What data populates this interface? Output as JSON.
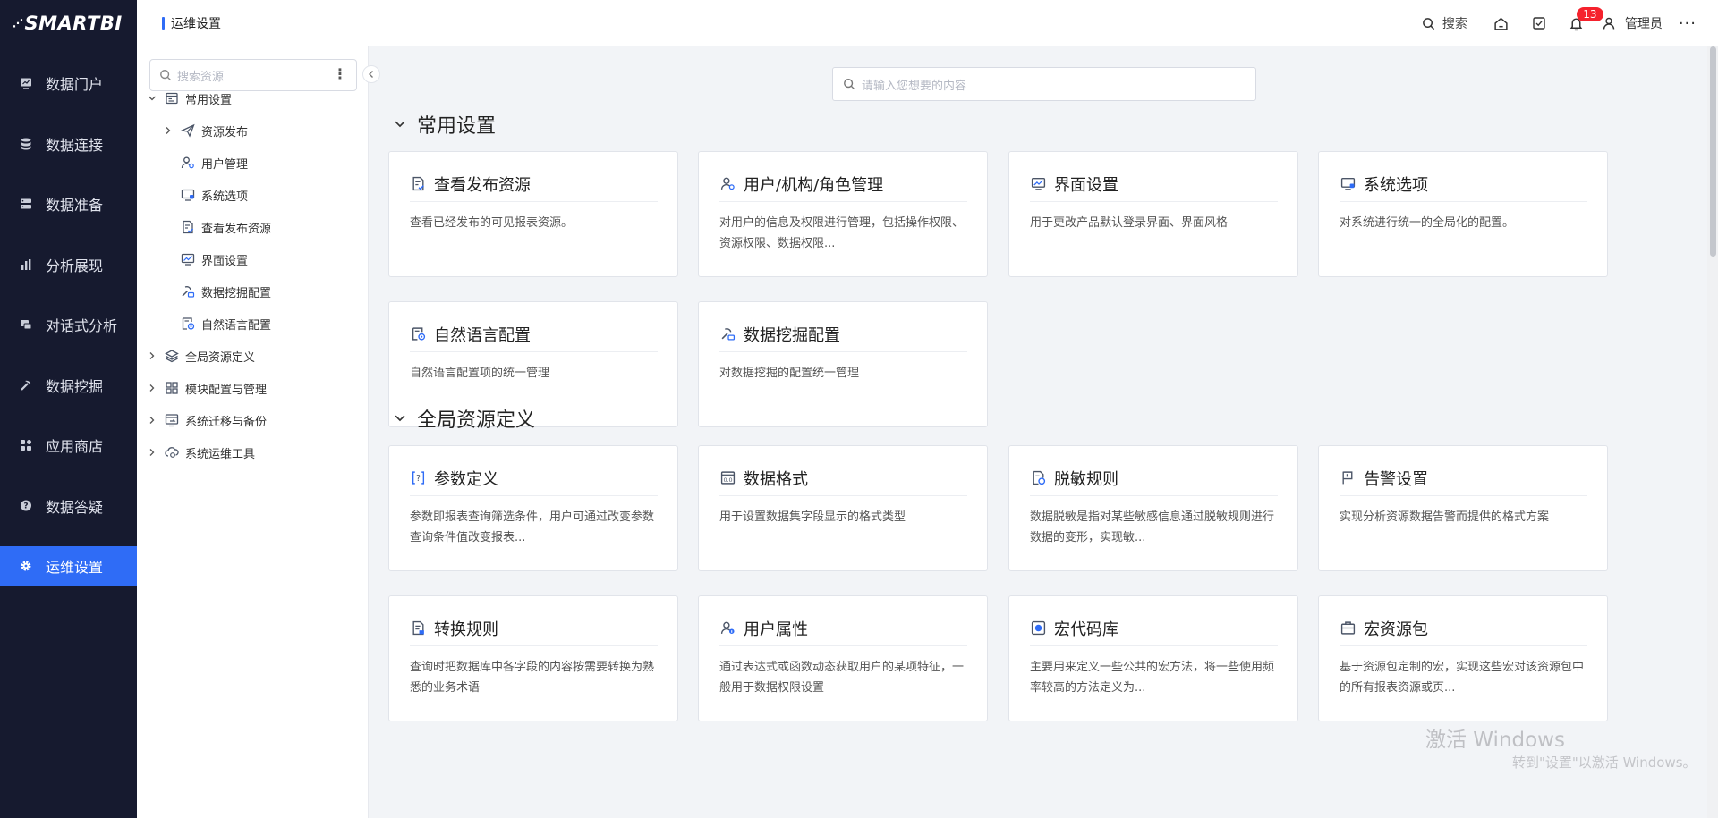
{
  "app": {
    "logo_text": "SMARTBI",
    "accent_color": "#2f6cf6",
    "nav_bg_color": "#161a2f"
  },
  "leftnav": {
    "items": [
      {
        "label": "数据门户",
        "icon": "monitor-chart-icon"
      },
      {
        "label": "数据连接",
        "icon": "database-icon"
      },
      {
        "label": "数据准备",
        "icon": "server-icon"
      },
      {
        "label": "分析展现",
        "icon": "bar-chart-icon"
      },
      {
        "label": "对话式分析",
        "icon": "chat-window-icon"
      },
      {
        "label": "数据挖掘",
        "icon": "pickaxe-icon"
      },
      {
        "label": "应用商店",
        "icon": "apps-grid-icon"
      },
      {
        "label": "数据答疑",
        "icon": "question-bubble-icon"
      },
      {
        "label": "运维设置",
        "icon": "gear-icon",
        "active": true
      }
    ]
  },
  "header": {
    "page_title": "运维设置",
    "search_label": "搜索",
    "notification_count": "13",
    "user_name": "管理员",
    "more_label": "···"
  },
  "tree": {
    "search_placeholder": "搜索资源",
    "kebab": "⋮",
    "rows": [
      {
        "label": "常用设置",
        "caret": "down",
        "icon": "settings-panel-icon",
        "level": 0
      },
      {
        "label": "资源发布",
        "caret": "right",
        "icon": "paper-plane-icon",
        "level": 1
      },
      {
        "label": "用户管理",
        "caret": "",
        "icon": "user-gear-icon",
        "level": 1
      },
      {
        "label": "系统选项",
        "caret": "",
        "icon": "monitor-settings-icon",
        "level": 1
      },
      {
        "label": "查看发布资源",
        "caret": "",
        "icon": "doc-check-icon",
        "level": 1
      },
      {
        "label": "界面设置",
        "caret": "",
        "icon": "monitor-layout-icon",
        "level": 1
      },
      {
        "label": "数据挖掘配置",
        "caret": "",
        "icon": "pickaxe-gear-icon",
        "level": 1
      },
      {
        "label": "自然语言配置",
        "caret": "",
        "icon": "nlp-config-icon",
        "level": 1
      },
      {
        "label": "全局资源定义",
        "caret": "right",
        "icon": "layers-icon",
        "level": 0
      },
      {
        "label": "模块配置与管理",
        "caret": "right",
        "icon": "modules-grid-icon",
        "level": 0
      },
      {
        "label": "系统迁移与备份",
        "caret": "right",
        "icon": "migrate-icon",
        "level": 0
      },
      {
        "label": "系统运维工具",
        "caret": "right",
        "icon": "cloud-tool-icon",
        "level": 0
      }
    ]
  },
  "main": {
    "search_placeholder": "请输入您想要的内容",
    "sections": [
      {
        "title": "常用设置",
        "cards": [
          {
            "title": "查看发布资源",
            "desc": "查看已经发布的可见报表资源。",
            "icon": "doc-check-icon"
          },
          {
            "title": "用户/机构/角色管理",
            "desc": "对用户的信息及权限进行管理，包括操作权限、资源权限、数据权限...",
            "icon": "user-gear-icon"
          },
          {
            "title": "界面设置",
            "desc": "用于更改产品默认登录界面、界面风格",
            "icon": "monitor-layout-icon"
          },
          {
            "title": "系统选项",
            "desc": "对系统进行统一的全局化的配置。",
            "icon": "monitor-settings-icon"
          },
          {
            "title": "自然语言配置",
            "desc": "自然语言配置项的统一管理",
            "icon": "nlp-config-icon"
          },
          {
            "title": "数据挖掘配置",
            "desc": "对数据挖掘的配置统一管理",
            "icon": "pickaxe-gear-icon"
          }
        ]
      },
      {
        "title": "全局资源定义",
        "cards": [
          {
            "title": "参数定义",
            "desc": "参数即报表查询筛选条件，用户可通过改变参数查询条件值改变报表...",
            "icon": "param-bracket-icon"
          },
          {
            "title": "数据格式",
            "desc": "用于设置数据集字段显示的格式类型",
            "icon": "data-format-icon"
          },
          {
            "title": "脱敏规则",
            "desc": "数据脱敏是指对某些敏感信息通过脱敏规则进行数据的变形，实现敏...",
            "icon": "mask-rule-icon"
          },
          {
            "title": "告警设置",
            "desc": "实现分析资源数据告警而提供的格式方案",
            "icon": "alarm-flag-icon"
          },
          {
            "title": "转换规则",
            "desc": "查询时把数据库中各字段的内容按需要转换为熟悉的业务术语",
            "icon": "convert-rule-icon"
          },
          {
            "title": "用户属性",
            "desc": "通过表达式或函数动态获取用户的某项特征，一般用于数据权限设置",
            "icon": "user-info-icon"
          },
          {
            "title": "宏代码库",
            "desc": "主要用来定义一些公共的宏方法，将一些使用频率较高的方法定义为...",
            "icon": "macro-code-icon"
          },
          {
            "title": "宏资源包",
            "desc": "基于资源包定制的宏，实现这些宏对该资源包中的所有报表资源或页...",
            "icon": "macro-package-icon"
          }
        ]
      }
    ]
  },
  "watermark": {
    "line1": "激活 Windows",
    "line2": "转到\"设置\"以激活 Windows。"
  }
}
